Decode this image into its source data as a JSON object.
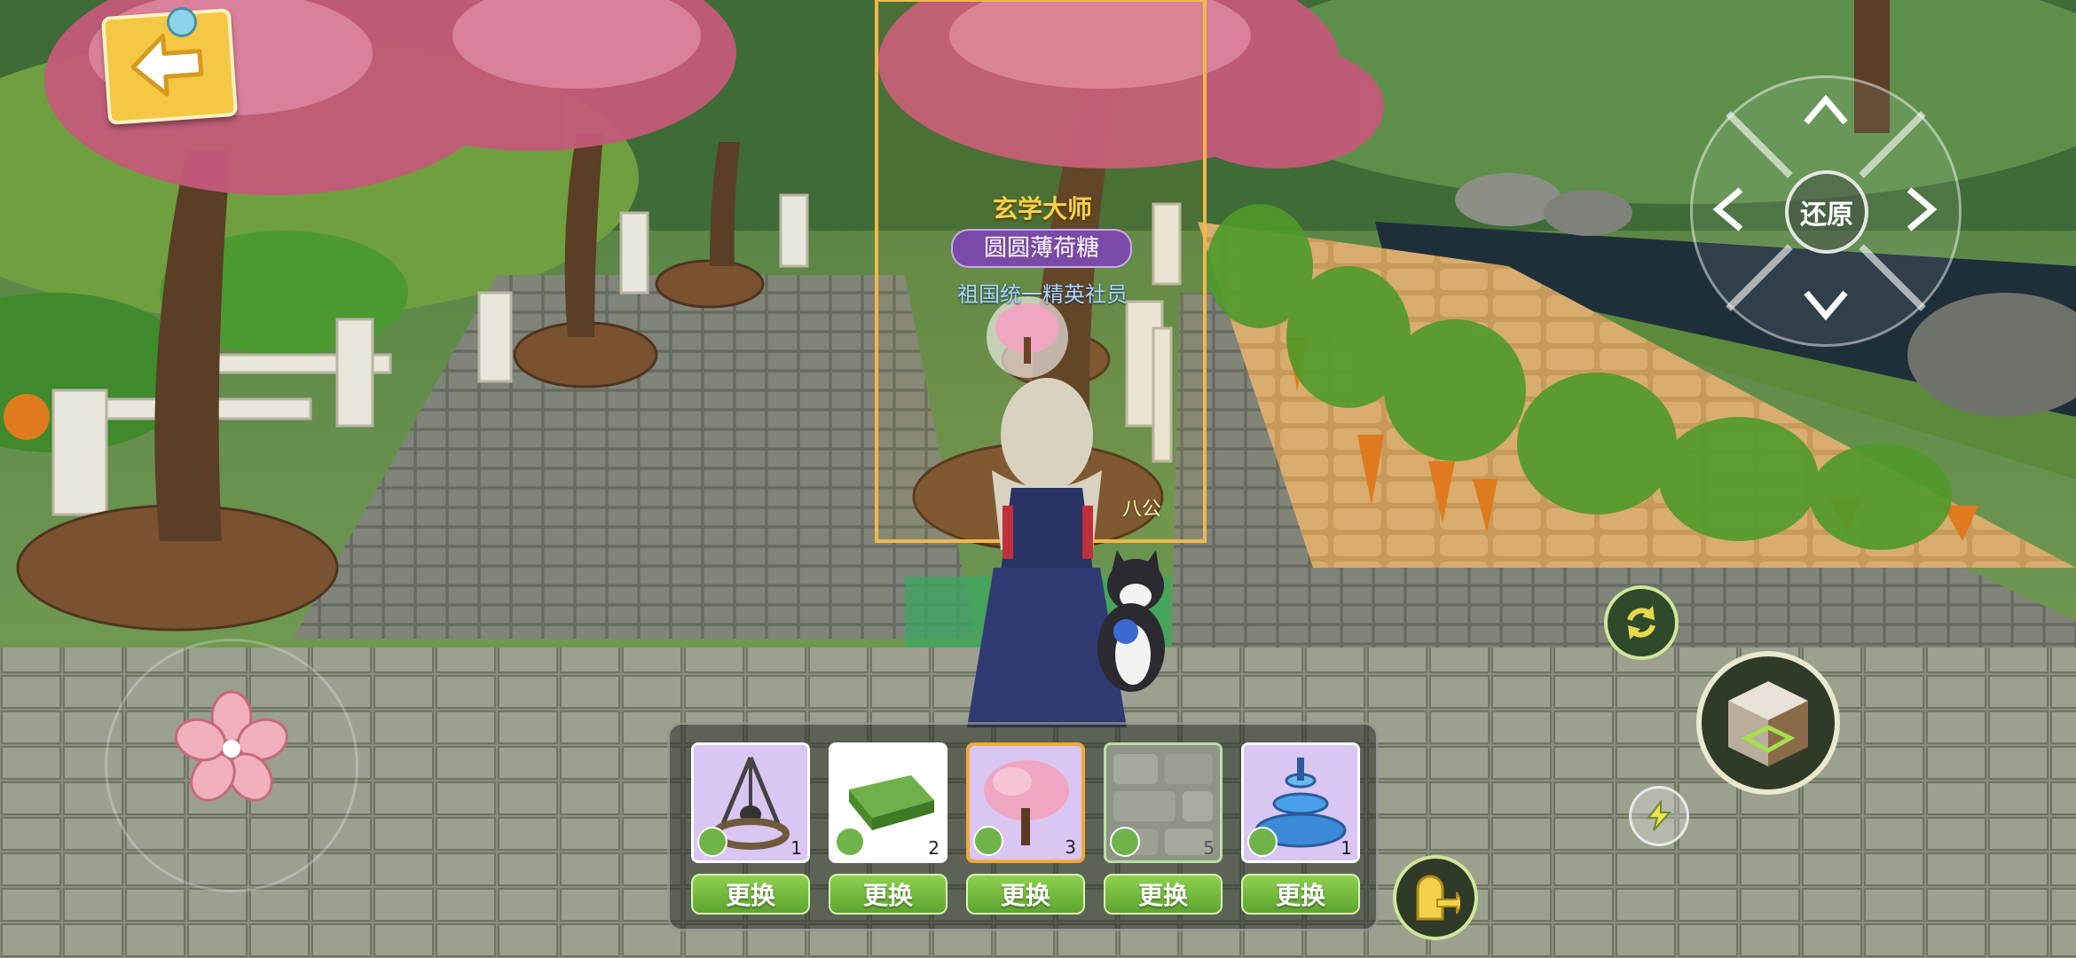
{
  "hud": {
    "back_icon": "back-arrow-icon",
    "camera_reset_label": "还原",
    "camera_arrows": [
      "chevron-up-icon",
      "chevron-down-icon",
      "chevron-left-icon",
      "chevron-right-icon"
    ],
    "rotate_icon": "rotate-icon",
    "build_icon": "build-cube-icon",
    "quick_icon": "lightning-icon",
    "exit_icon": "exit-door-icon",
    "joystick_icon": "cherry-blossom-icon"
  },
  "character": {
    "title": "玄学大师",
    "name": "圆圆薄荷糖",
    "guild": "祖国统一精英社员"
  },
  "pet": {
    "name": "八公"
  },
  "toolbar": {
    "swap_label": "更换",
    "items": [
      {
        "icon": "fire-pit-icon",
        "count": "1",
        "bg": "#d9c6f3"
      },
      {
        "icon": "grass-tile-icon",
        "count": "2",
        "bg": "#ffffff"
      },
      {
        "icon": "cherry-tree-icon",
        "count": "3",
        "bg": "#d9c6f3"
      },
      {
        "icon": "stone-floor-icon",
        "count": "5",
        "bg": "#ffffff"
      },
      {
        "icon": "fountain-icon",
        "count": "1",
        "bg": "#d9c6f3"
      }
    ]
  },
  "colors": {
    "accent_green": "#6fb34a",
    "slot_purple": "#d9c6f3",
    "selected_border": "#f2a83a"
  }
}
